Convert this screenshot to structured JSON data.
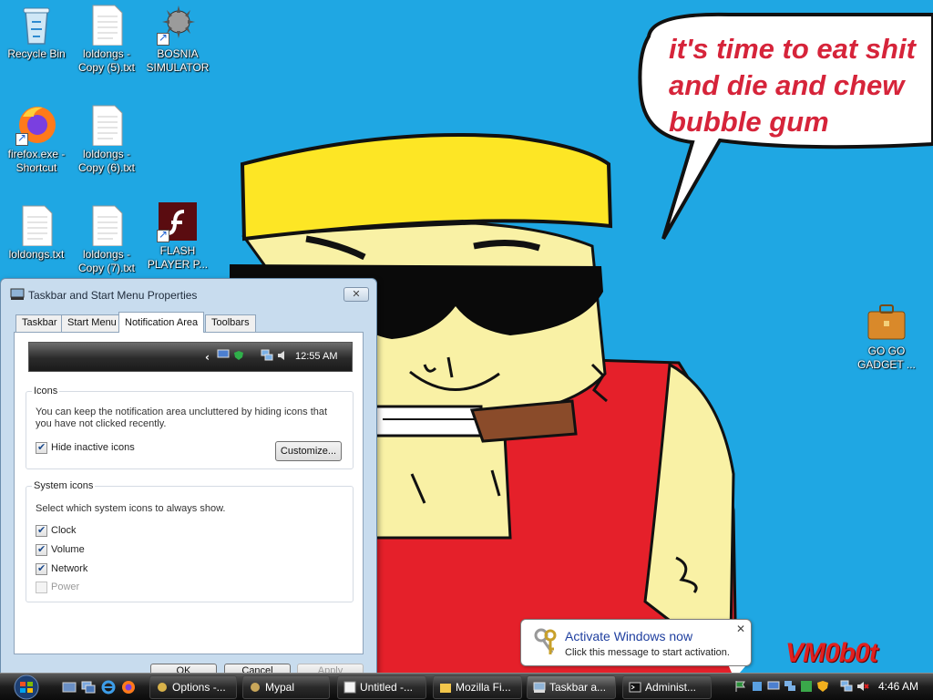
{
  "wallpaper": {
    "speech_text": "it's time to eat shit\nand die and chew\nbubble gum",
    "signature": "VM0b0t"
  },
  "desktop_icons": [
    {
      "label": "Recycle Bin",
      "icon": "recycle-bin-icon"
    },
    {
      "label": "loldongs -\nCopy (5).txt",
      "icon": "text-file-icon"
    },
    {
      "label": "BOSNIA\nSIMULATOR",
      "icon": "spiked-ball-icon"
    },
    {
      "label": "firefox.exe -\nShortcut",
      "icon": "firefox-icon"
    },
    {
      "label": "loldongs -\nCopy (6).txt",
      "icon": "text-file-icon"
    },
    {
      "label": "loldongs.txt",
      "icon": "text-file-icon"
    },
    {
      "label": "loldongs -\nCopy (7).txt",
      "icon": "text-file-icon"
    },
    {
      "label": "FLASH\nPLAYER P...",
      "icon": "flash-player-icon"
    },
    {
      "label": "GO GO\nGADGET ...",
      "icon": "briefcase-icon"
    }
  ],
  "dialog": {
    "title": "Taskbar and Start Menu Properties",
    "close_label": "✕",
    "tabs": [
      "Taskbar",
      "Start Menu",
      "Notification Area",
      "Toolbars"
    ],
    "active_tab": "Notification Area",
    "preview_clock": "12:55 AM",
    "icons_group": {
      "title": "Icons",
      "description": "You can keep the notification area uncluttered by hiding icons that you have not clicked recently.",
      "hide_inactive_label": "Hide inactive icons",
      "hide_inactive_checked": true,
      "customize_label": "Customize..."
    },
    "system_icons_group": {
      "title": "System icons",
      "description": "Select which system icons to always show.",
      "items": [
        {
          "label": "Clock",
          "checked": true,
          "enabled": true
        },
        {
          "label": "Volume",
          "checked": true,
          "enabled": true
        },
        {
          "label": "Network",
          "checked": true,
          "enabled": true
        },
        {
          "label": "Power",
          "checked": false,
          "enabled": false
        }
      ]
    },
    "buttons": {
      "ok": "OK",
      "cancel": "Cancel",
      "apply": "Apply"
    }
  },
  "balloon": {
    "title": "Activate Windows now",
    "text": "Click this message to start activation.",
    "close_label": "✕"
  },
  "taskbar": {
    "buttons": [
      {
        "label": "Options -...",
        "icon": "options-icon"
      },
      {
        "label": "Mypal",
        "icon": "mypal-icon"
      },
      {
        "label": "Untitled -...",
        "icon": "paint-icon"
      },
      {
        "label": "Mozilla Fi...",
        "icon": "folder-icon"
      },
      {
        "label": "Taskbar a...",
        "icon": "taskbar-properties-icon"
      },
      {
        "label": "Administ...",
        "icon": "command-prompt-icon"
      }
    ],
    "clock": "4:46 AM"
  },
  "colors": {
    "desktop_background": "#1fa7e3",
    "speech_text": "#d6243a",
    "balloon_title": "#1f3f9f"
  }
}
